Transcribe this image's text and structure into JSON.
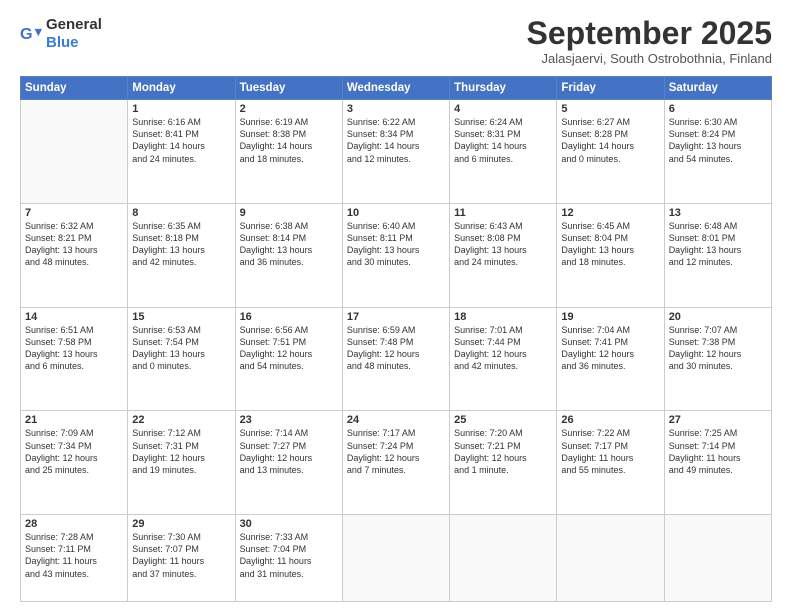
{
  "logo": {
    "general": "General",
    "blue": "Blue"
  },
  "header": {
    "month": "September 2025",
    "location": "Jalasjaervi, South Ostrobothnia, Finland"
  },
  "days": [
    "Sunday",
    "Monday",
    "Tuesday",
    "Wednesday",
    "Thursday",
    "Friday",
    "Saturday"
  ],
  "weeks": [
    [
      {
        "num": "",
        "info": ""
      },
      {
        "num": "1",
        "info": "Sunrise: 6:16 AM\nSunset: 8:41 PM\nDaylight: 14 hours\nand 24 minutes."
      },
      {
        "num": "2",
        "info": "Sunrise: 6:19 AM\nSunset: 8:38 PM\nDaylight: 14 hours\nand 18 minutes."
      },
      {
        "num": "3",
        "info": "Sunrise: 6:22 AM\nSunset: 8:34 PM\nDaylight: 14 hours\nand 12 minutes."
      },
      {
        "num": "4",
        "info": "Sunrise: 6:24 AM\nSunset: 8:31 PM\nDaylight: 14 hours\nand 6 minutes."
      },
      {
        "num": "5",
        "info": "Sunrise: 6:27 AM\nSunset: 8:28 PM\nDaylight: 14 hours\nand 0 minutes."
      },
      {
        "num": "6",
        "info": "Sunrise: 6:30 AM\nSunset: 8:24 PM\nDaylight: 13 hours\nand 54 minutes."
      }
    ],
    [
      {
        "num": "7",
        "info": "Sunrise: 6:32 AM\nSunset: 8:21 PM\nDaylight: 13 hours\nand 48 minutes."
      },
      {
        "num": "8",
        "info": "Sunrise: 6:35 AM\nSunset: 8:18 PM\nDaylight: 13 hours\nand 42 minutes."
      },
      {
        "num": "9",
        "info": "Sunrise: 6:38 AM\nSunset: 8:14 PM\nDaylight: 13 hours\nand 36 minutes."
      },
      {
        "num": "10",
        "info": "Sunrise: 6:40 AM\nSunset: 8:11 PM\nDaylight: 13 hours\nand 30 minutes."
      },
      {
        "num": "11",
        "info": "Sunrise: 6:43 AM\nSunset: 8:08 PM\nDaylight: 13 hours\nand 24 minutes."
      },
      {
        "num": "12",
        "info": "Sunrise: 6:45 AM\nSunset: 8:04 PM\nDaylight: 13 hours\nand 18 minutes."
      },
      {
        "num": "13",
        "info": "Sunrise: 6:48 AM\nSunset: 8:01 PM\nDaylight: 13 hours\nand 12 minutes."
      }
    ],
    [
      {
        "num": "14",
        "info": "Sunrise: 6:51 AM\nSunset: 7:58 PM\nDaylight: 13 hours\nand 6 minutes."
      },
      {
        "num": "15",
        "info": "Sunrise: 6:53 AM\nSunset: 7:54 PM\nDaylight: 13 hours\nand 0 minutes."
      },
      {
        "num": "16",
        "info": "Sunrise: 6:56 AM\nSunset: 7:51 PM\nDaylight: 12 hours\nand 54 minutes."
      },
      {
        "num": "17",
        "info": "Sunrise: 6:59 AM\nSunset: 7:48 PM\nDaylight: 12 hours\nand 48 minutes."
      },
      {
        "num": "18",
        "info": "Sunrise: 7:01 AM\nSunset: 7:44 PM\nDaylight: 12 hours\nand 42 minutes."
      },
      {
        "num": "19",
        "info": "Sunrise: 7:04 AM\nSunset: 7:41 PM\nDaylight: 12 hours\nand 36 minutes."
      },
      {
        "num": "20",
        "info": "Sunrise: 7:07 AM\nSunset: 7:38 PM\nDaylight: 12 hours\nand 30 minutes."
      }
    ],
    [
      {
        "num": "21",
        "info": "Sunrise: 7:09 AM\nSunset: 7:34 PM\nDaylight: 12 hours\nand 25 minutes."
      },
      {
        "num": "22",
        "info": "Sunrise: 7:12 AM\nSunset: 7:31 PM\nDaylight: 12 hours\nand 19 minutes."
      },
      {
        "num": "23",
        "info": "Sunrise: 7:14 AM\nSunset: 7:27 PM\nDaylight: 12 hours\nand 13 minutes."
      },
      {
        "num": "24",
        "info": "Sunrise: 7:17 AM\nSunset: 7:24 PM\nDaylight: 12 hours\nand 7 minutes."
      },
      {
        "num": "25",
        "info": "Sunrise: 7:20 AM\nSunset: 7:21 PM\nDaylight: 12 hours\nand 1 minute."
      },
      {
        "num": "26",
        "info": "Sunrise: 7:22 AM\nSunset: 7:17 PM\nDaylight: 11 hours\nand 55 minutes."
      },
      {
        "num": "27",
        "info": "Sunrise: 7:25 AM\nSunset: 7:14 PM\nDaylight: 11 hours\nand 49 minutes."
      }
    ],
    [
      {
        "num": "28",
        "info": "Sunrise: 7:28 AM\nSunset: 7:11 PM\nDaylight: 11 hours\nand 43 minutes."
      },
      {
        "num": "29",
        "info": "Sunrise: 7:30 AM\nSunset: 7:07 PM\nDaylight: 11 hours\nand 37 minutes."
      },
      {
        "num": "30",
        "info": "Sunrise: 7:33 AM\nSunset: 7:04 PM\nDaylight: 11 hours\nand 31 minutes."
      },
      {
        "num": "",
        "info": ""
      },
      {
        "num": "",
        "info": ""
      },
      {
        "num": "",
        "info": ""
      },
      {
        "num": "",
        "info": ""
      }
    ]
  ]
}
